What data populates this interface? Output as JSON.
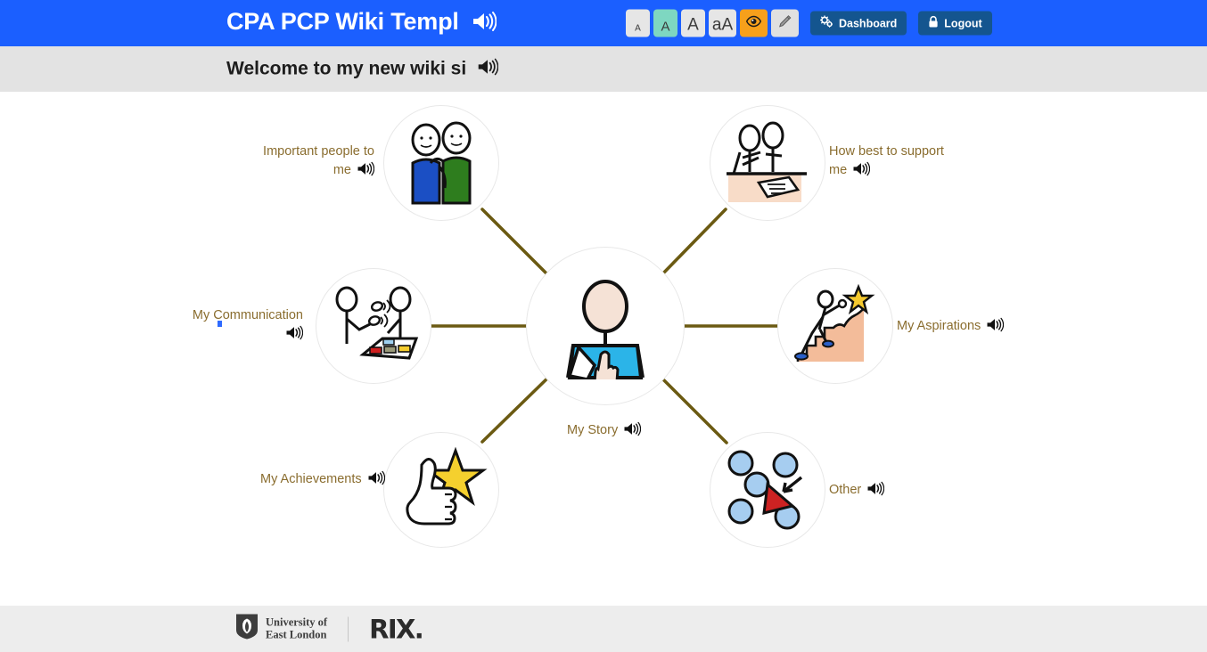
{
  "header": {
    "title": "CPA PCP Wiki Templ",
    "title_speaker_icon": "speaker-icon",
    "font_buttons": [
      {
        "label": "A",
        "name": "font-size-smallest",
        "active": false
      },
      {
        "label": "A",
        "name": "font-size-small",
        "active": true
      },
      {
        "label": "A",
        "name": "font-size-large",
        "active": false
      },
      {
        "label": "aA",
        "name": "font-size-largest",
        "active": false
      }
    ],
    "eye_button": {
      "icon": "eye-icon",
      "color": "#f7a01b"
    },
    "pencil_button": {
      "icon": "pencil-icon",
      "color": "#e0e0e0"
    },
    "dashboard_button": {
      "label": "Dashboard",
      "icon": "cogs-icon"
    },
    "logout_button": {
      "label": "Logout",
      "icon": "lock-icon"
    },
    "bg_color": "#1b5fff",
    "nav_button_color": "#14558f"
  },
  "subtitle": {
    "text": "Welcome to my new wiki si",
    "speaker_icon": "speaker-icon",
    "bg_color": "#e3e3e3"
  },
  "mindmap": {
    "edge_color": "#6b5a12",
    "label_color": "#8a6d2f",
    "center": {
      "label": "My Story",
      "icon": "person-pointing-self-icon",
      "speaker_icon": "speaker-icon"
    },
    "nodes": [
      {
        "label": "Important people to me",
        "icon": "two-people-icon",
        "speaker_icon": "speaker-icon",
        "position": "top-left"
      },
      {
        "label": "How best to support me",
        "icon": "two-people-at-table-icon",
        "speaker_icon": "speaker-icon",
        "position": "top-right"
      },
      {
        "label": "My Communication",
        "icon": "communication-board-icon",
        "speaker_icon": "speaker-icon",
        "position": "left"
      },
      {
        "label": "My Aspirations",
        "icon": "climbing-to-star-icon",
        "speaker_icon": "speaker-icon",
        "position": "right"
      },
      {
        "label": "My Achievements",
        "icon": "thumbs-up-star-icon",
        "speaker_icon": "speaker-icon",
        "position": "bottom-left"
      },
      {
        "label": "Other",
        "icon": "circles-triangle-icon",
        "speaker_icon": "speaker-icon",
        "position": "bottom-right"
      }
    ]
  },
  "footer": {
    "university_line1": "University of",
    "university_line2": "East London",
    "university_icon": "uel-crest-icon",
    "rix_label": "RIX.",
    "bg_color": "#ededed"
  }
}
